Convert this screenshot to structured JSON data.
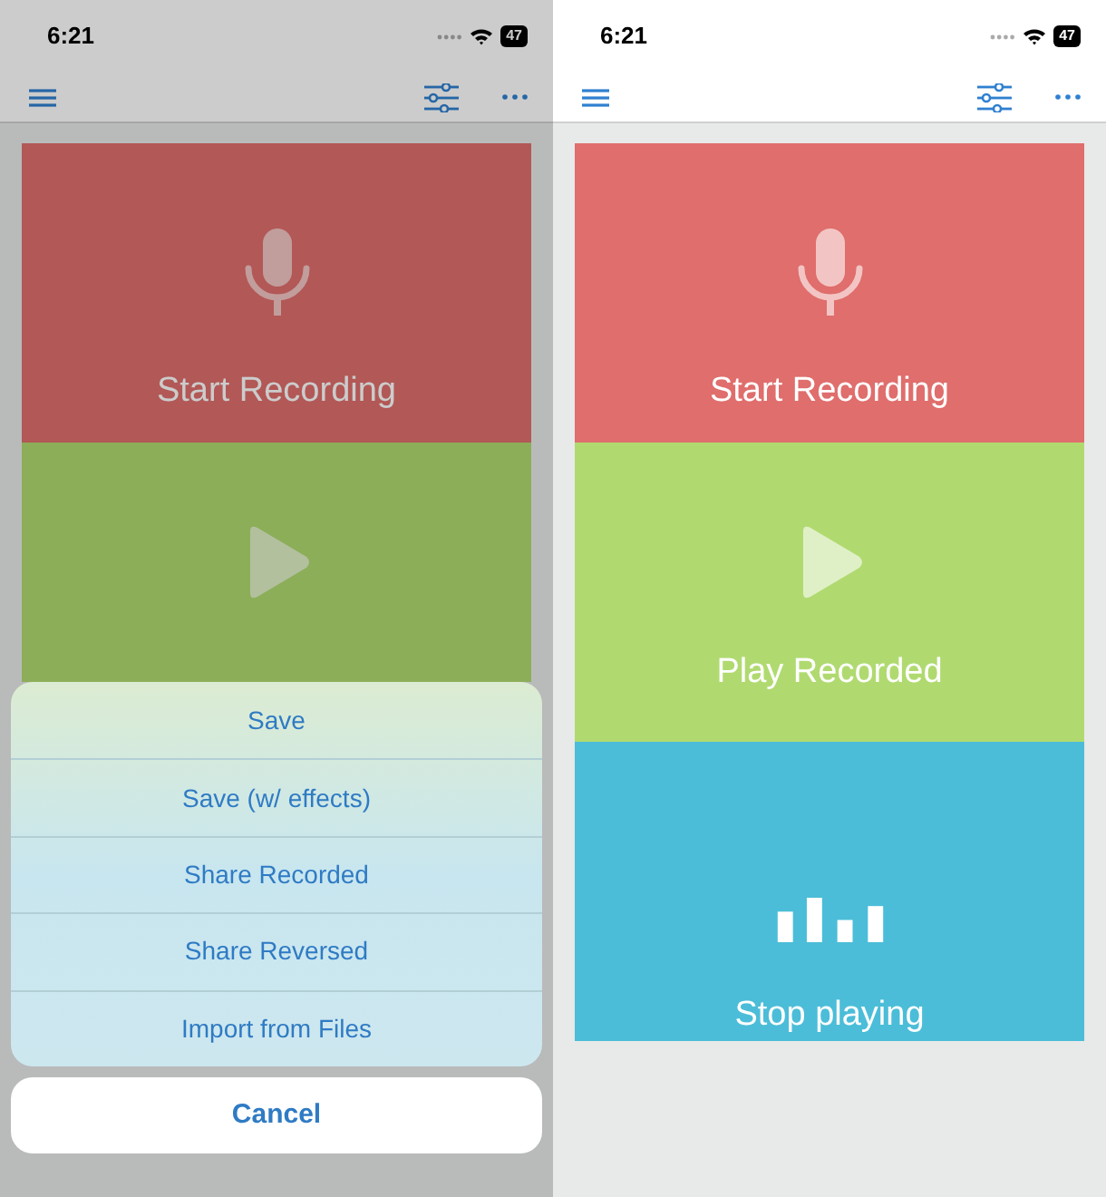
{
  "screens": [
    {
      "status_bar": {
        "time": "6:21",
        "battery": "47"
      },
      "dimmed": true,
      "tiles": [
        {
          "kind": "record",
          "label": "Start Recording"
        },
        {
          "kind": "play"
        }
      ],
      "action_sheet": {
        "items": [
          "Save",
          "Save (w/ effects)",
          "Share Recorded",
          "Share Reversed",
          "Import from Files"
        ],
        "cancel": "Cancel"
      }
    },
    {
      "status_bar": {
        "time": "6:21",
        "battery": "47"
      },
      "dimmed": false,
      "tiles": [
        {
          "kind": "record",
          "label": "Start Recording"
        },
        {
          "kind": "play",
          "label": "Play Recorded"
        },
        {
          "kind": "stop",
          "label": "Stop playing"
        }
      ]
    }
  ]
}
